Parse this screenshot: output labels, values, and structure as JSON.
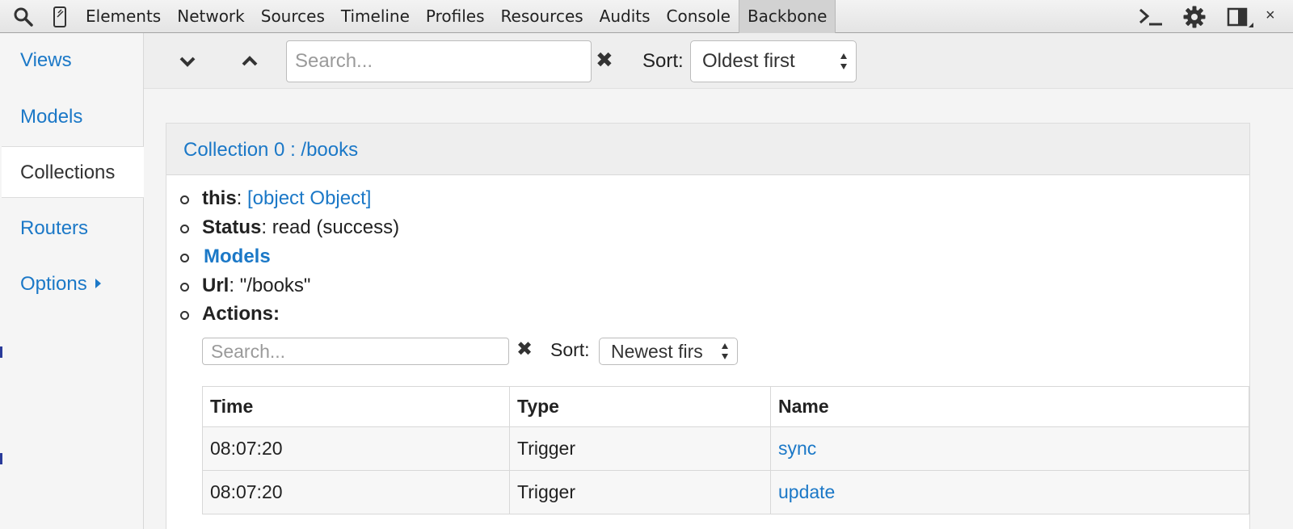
{
  "devtools": {
    "tabs": [
      {
        "label": "Elements"
      },
      {
        "label": "Network"
      },
      {
        "label": "Sources"
      },
      {
        "label": "Timeline"
      },
      {
        "label": "Profiles"
      },
      {
        "label": "Resources"
      },
      {
        "label": "Audits"
      },
      {
        "label": "Console"
      },
      {
        "label": "Backbone",
        "active": true
      }
    ],
    "close_label": "×"
  },
  "sidebar": {
    "items": [
      {
        "label": "Views"
      },
      {
        "label": "Models"
      },
      {
        "label": "Collections",
        "active": true
      },
      {
        "label": "Routers"
      },
      {
        "label": "Options"
      }
    ]
  },
  "toolbar": {
    "search_placeholder": "Search...",
    "clear_symbol": "✖",
    "sort_label": "Sort:",
    "sort_value": "Oldest first"
  },
  "collection": {
    "title": "Collection 0 : /books",
    "this_key": "this",
    "this_value": "[object Object]",
    "status_key": "Status",
    "status_value": "read (success)",
    "models_link": "Models",
    "url_key": "Url",
    "url_value": "\"/books\"",
    "actions_key": "Actions:",
    "actions": {
      "search_placeholder": "Search...",
      "clear_symbol": "✖",
      "sort_label": "Sort:",
      "sort_value": "Newest firs",
      "columns": [
        "Time",
        "Type",
        "Name"
      ],
      "rows": [
        {
          "time": "08:07:20",
          "type": "Trigger",
          "name": "sync"
        },
        {
          "time": "08:07:20",
          "type": "Trigger",
          "name": "update"
        }
      ]
    }
  },
  "colors": {
    "link": "#1b78c7",
    "toolbar_bg": "#e9e9e9",
    "active_tab_bg": "#d2d2d2"
  }
}
